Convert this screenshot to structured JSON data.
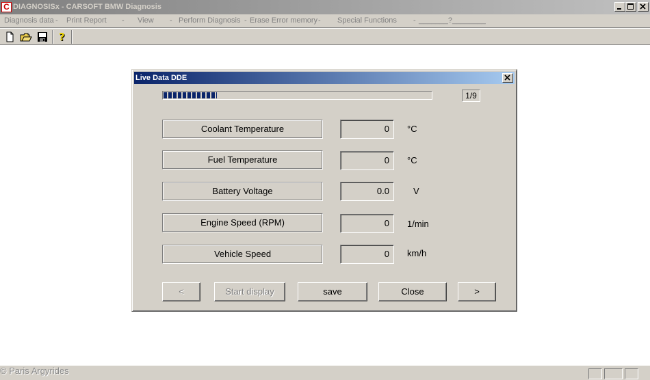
{
  "window": {
    "icon_letter": "C",
    "title": "DIAGNOSISx - CARSOFT BMW Diagnosis"
  },
  "menu": {
    "items": [
      "Diagnosis data",
      "Print Report",
      "View",
      "Perform Diagnosis",
      "Erase Error memory",
      "Special Functions",
      "_______?________"
    ],
    "separator": "-"
  },
  "toolbar": {
    "buttons": [
      "new-icon",
      "open-icon",
      "save-icon",
      "help-icon"
    ]
  },
  "dialog": {
    "title": "Live Data DDE",
    "page": "1/9",
    "progress_fraction": 0.2,
    "rows": [
      {
        "label": "Coolant Temperature",
        "value": "0",
        "unit": "°C"
      },
      {
        "label": "Fuel Temperature",
        "value": "0",
        "unit": "°C"
      },
      {
        "label": "Battery Voltage",
        "value": "0.0",
        "unit": "V"
      },
      {
        "label": "Engine Speed (RPM)",
        "value": "0",
        "unit": "1/min"
      },
      {
        "label": "Vehicle Speed",
        "value": "0",
        "unit": "km/h"
      }
    ],
    "buttons": {
      "prev": "<",
      "start": "Start display",
      "save": "save",
      "close": "Close",
      "next": ">"
    }
  },
  "status": {
    "copyright": "© Paris Argyrides"
  },
  "colors": {
    "dialog_title_start": "#0a246a",
    "dialog_title_end": "#a6caf0",
    "face": "#d4d0c8",
    "progress": "#0a246a"
  }
}
